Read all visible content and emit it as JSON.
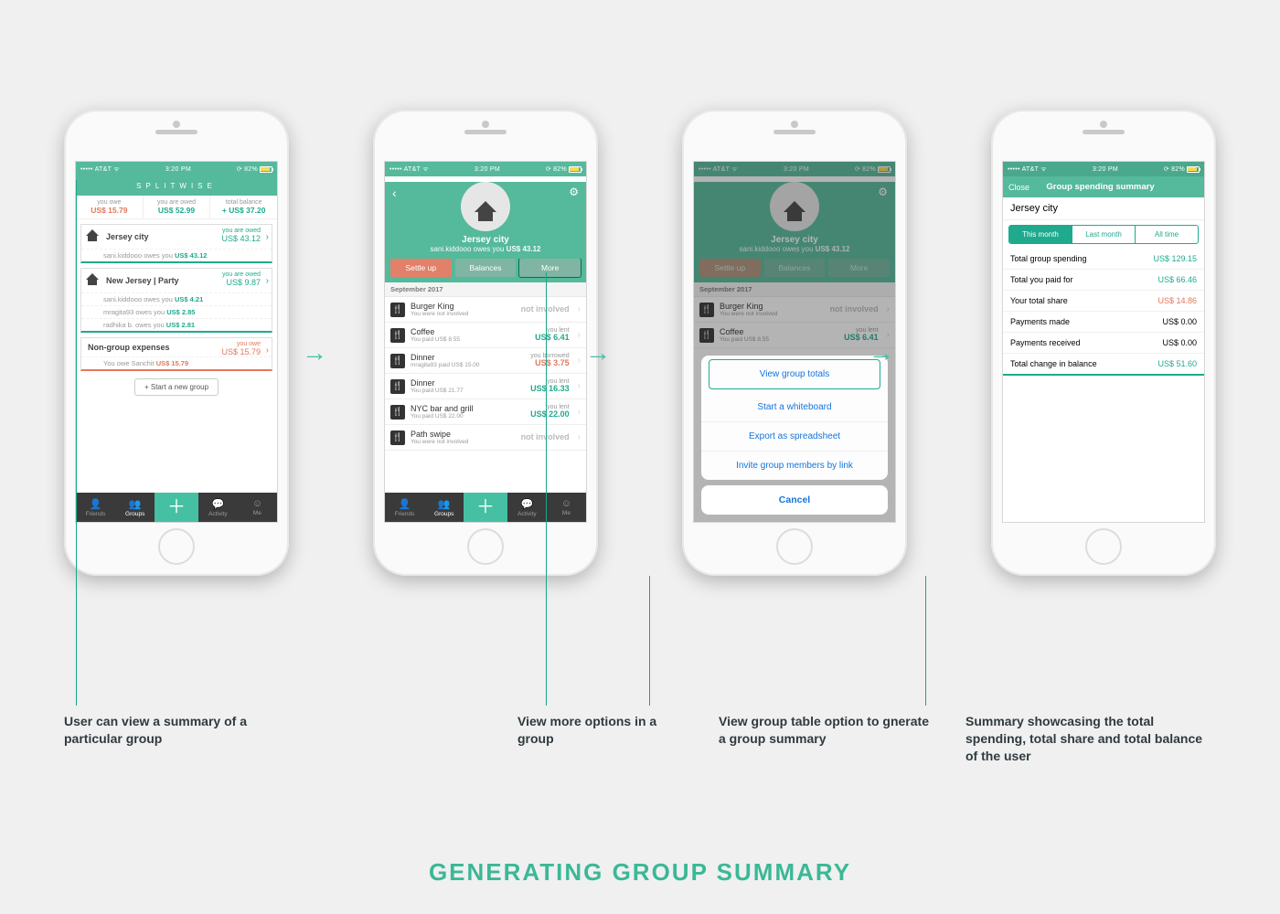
{
  "status": {
    "carrier": "••••• AT&T ᯤ",
    "time": "3:20 PM",
    "battery": "82%"
  },
  "brand": "SPLITWISE",
  "tabs": {
    "friends": "Friends",
    "groups": "Groups",
    "activity": "Activity",
    "me": "Me"
  },
  "screen1": {
    "summary": {
      "owe_l": "you owe",
      "owe_v": "US$ 15.79",
      "owed_l": "you are owed",
      "owed_v": "US$ 52.99",
      "bal_l": "total balance",
      "bal_v": "+ US$ 37.20"
    },
    "groups": [
      {
        "name": "Jersey city",
        "status_l": "you are owed",
        "status_v": "US$ 43.12",
        "status_class": "green",
        "lines": [
          {
            "text": "sani.kiddooo owes you ",
            "amt": "US$ 43.12",
            "class": "green"
          }
        ]
      },
      {
        "name": "New Jersey | Party",
        "status_l": "you are owed",
        "status_v": "US$ 9.87",
        "status_class": "green",
        "lines": [
          {
            "text": "sani.kiddooo owes you ",
            "amt": "US$ 4.21",
            "class": "green"
          },
          {
            "text": "mragita93 owes you ",
            "amt": "US$ 2.85",
            "class": "green"
          },
          {
            "text": "radhika b. owes you ",
            "amt": "US$ 2.81",
            "class": "green"
          }
        ]
      }
    ],
    "nongroup": {
      "title": "Non-group expenses",
      "status_l": "you owe",
      "status_v": "US$ 15.79",
      "status_class": "orange",
      "line": {
        "text": "You owe Sanchit ",
        "amt": "US$ 15.79",
        "class": "orange"
      }
    },
    "start_group": "+ Start a new group"
  },
  "screen2": {
    "group_name": "Jersey city",
    "subline_a": "sani.kiddooo owes you ",
    "subline_b": "US$ 43.12",
    "buttons": {
      "settle": "Settle up",
      "balances": "Balances",
      "more": "More"
    },
    "section": "September 2017",
    "items": [
      {
        "title": "Burger King",
        "sub": "You were not involved",
        "rl": "not involved",
        "amt": "",
        "class": ""
      },
      {
        "title": "Coffee",
        "sub": "You paid US$ 8.55",
        "rl": "you lent",
        "amt": "US$ 6.41",
        "class": "green"
      },
      {
        "title": "Dinner",
        "sub": "mragita93 paid US$ 15.00",
        "rl": "you borrowed",
        "amt": "US$ 3.75",
        "class": "orange"
      },
      {
        "title": "Dinner",
        "sub": "You paid US$ 21.77",
        "rl": "you lent",
        "amt": "US$ 16.33",
        "class": "green"
      },
      {
        "title": "NYC bar and grill",
        "sub": "You paid US$ 22.00",
        "rl": "you lent",
        "amt": "US$ 22.00",
        "class": "green"
      },
      {
        "title": "Path swipe",
        "sub": "You were not involved",
        "rl": "not involved",
        "amt": "",
        "class": ""
      }
    ]
  },
  "screen3": {
    "options": [
      "View group totals",
      "Start a whiteboard",
      "Export as spreadsheet",
      "Invite group members by link"
    ],
    "cancel": "Cancel",
    "items": [
      {
        "title": "Burger King",
        "sub": "You were not involved",
        "rl": "not involved",
        "amt": "",
        "class": ""
      },
      {
        "title": "Coffee",
        "sub": "You paid US$ 8.55",
        "rl": "you lent",
        "amt": "US$ 6.41",
        "class": "green"
      }
    ]
  },
  "screen4": {
    "close": "Close",
    "title": "Group spending summary",
    "city": "Jersey city",
    "segments": [
      "This month",
      "Last month",
      "All time"
    ],
    "rows": [
      {
        "k": "Total group spending",
        "v": "US$ 129.15",
        "class": "green"
      },
      {
        "k": "Total you paid for",
        "v": "US$ 66.46",
        "class": "green"
      },
      {
        "k": "Your total share",
        "v": "US$ 14.86",
        "class": "orange"
      },
      {
        "k": "Payments made",
        "v": "US$ 0.00",
        "class": ""
      },
      {
        "k": "Payments received",
        "v": "US$ 0.00",
        "class": ""
      },
      {
        "k": "Total change in balance",
        "v": "US$ 51.60",
        "class": "green"
      }
    ]
  },
  "captions": [
    "User can view a summary of a particular group",
    "View more options in a group",
    "View group table option to gnerate a group summary",
    "Summary showcasing the total spending, total share and total balance of the user"
  ],
  "big_title": "GENERATING GROUP SUMMARY"
}
